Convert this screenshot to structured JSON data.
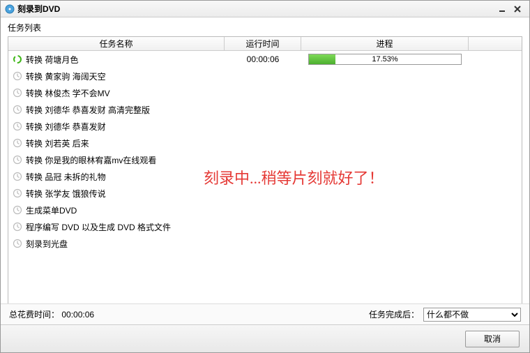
{
  "window": {
    "title": "刻录到DVD"
  },
  "section_label": "任务列表",
  "columns": {
    "name": "任务名称",
    "time": "运行时间",
    "progress": "进程"
  },
  "active_task": {
    "label": "转换 荷塘月色",
    "time": "00:00:06",
    "progress_pct": "17.53%",
    "progress_value": 17.53
  },
  "pending_tasks": [
    "转换 黄家驹 海阔天空",
    "转换 林俊杰 学不会MV",
    "转换 刘德华 恭喜发财 高清完整版",
    "转换 刘德华 恭喜发财",
    "转换 刘若英 后来",
    "转换 你是我的眼林宥嘉mv在线观看",
    "转换 品冠 未拆的礼物",
    "转换 张学友 饿狼传说",
    "生成菜单DVD",
    "程序编写 DVD 以及生成 DVD 格式文件",
    "刻录到光盘"
  ],
  "watermark": "刻录中...稍等片刻就好了！",
  "footer": {
    "total_time_label": "总花费时间：",
    "total_time_value": "00:00:06",
    "after_label": "任务完成后：",
    "after_selected": "什么都不做",
    "cancel": "取消"
  }
}
